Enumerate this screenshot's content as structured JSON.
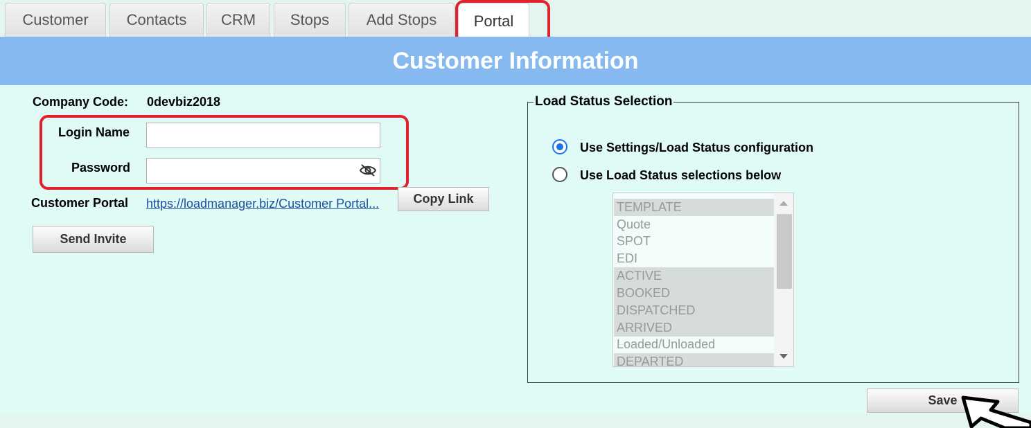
{
  "tabs": [
    {
      "label": "Customer"
    },
    {
      "label": "Contacts"
    },
    {
      "label": "CRM"
    },
    {
      "label": "Stops"
    },
    {
      "label": "Add Stops"
    },
    {
      "label": "Portal",
      "active": true
    }
  ],
  "header": {
    "title": "Customer Information"
  },
  "form": {
    "company_code_label": "Company Code:",
    "company_code_value": "0devbiz2018",
    "login_name_label": "Login Name",
    "login_name_value": "",
    "password_label": "Password",
    "password_value": "",
    "portal_label": "Customer Portal",
    "portal_link": "https://loadmanager.biz/Customer Portal...",
    "copy_link_label": "Copy Link",
    "send_invite_label": "Send Invite"
  },
  "load_status": {
    "legend": "Load Status Selection",
    "option_settings": "Use Settings/Load Status configuration",
    "option_below": "Use Load Status selections below",
    "selected_option": "settings",
    "statuses": [
      {
        "label": "TEMPLATE",
        "selected": true
      },
      {
        "label": "Quote",
        "selected": false
      },
      {
        "label": "SPOT",
        "selected": false
      },
      {
        "label": "EDI",
        "selected": false
      },
      {
        "label": "ACTIVE",
        "selected": true
      },
      {
        "label": "BOOKED",
        "selected": true
      },
      {
        "label": "DISPATCHED",
        "selected": true
      },
      {
        "label": "ARRIVED",
        "selected": true
      },
      {
        "label": "Loaded/Unloaded",
        "selected": false
      },
      {
        "label": "DEPARTED",
        "selected": true
      }
    ]
  },
  "save_label": "Save",
  "colors": {
    "header_bg": "#85b9f0",
    "content_bg": "#e0faf6",
    "highlight": "#e0212b",
    "radio_accent": "#1a73e8"
  }
}
